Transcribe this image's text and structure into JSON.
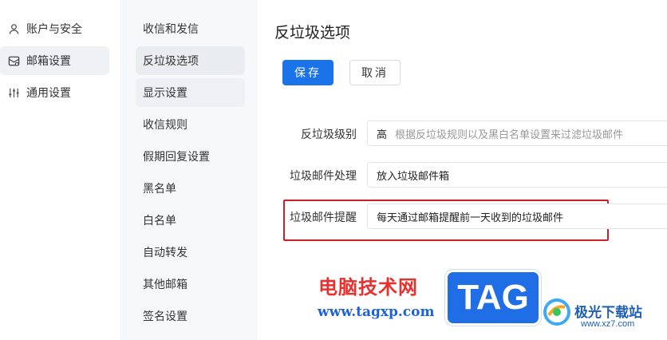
{
  "nav_primary": {
    "items": [
      {
        "label": "账户与安全",
        "icon": "user-icon"
      },
      {
        "label": "邮箱设置",
        "icon": "mailbox-icon"
      },
      {
        "label": "通用设置",
        "icon": "sliders-icon"
      }
    ],
    "active_index": 1
  },
  "nav_secondary": {
    "items": [
      {
        "label": "收信和发信"
      },
      {
        "label": "反垃圾选项"
      },
      {
        "label": "显示设置"
      },
      {
        "label": "收信规则"
      },
      {
        "label": "假期回复设置"
      },
      {
        "label": "黑名单"
      },
      {
        "label": "白名单"
      },
      {
        "label": "自动转发"
      },
      {
        "label": "其他邮箱"
      },
      {
        "label": "签名设置"
      }
    ],
    "active_index": 1
  },
  "main": {
    "title": "反垃圾选项",
    "save_label": "保存",
    "cancel_label": "取消",
    "rows": [
      {
        "label": "反垃圾级别",
        "value": "高",
        "hint": "根据反垃圾规则以及黑白名单设置来过滤垃圾邮件"
      },
      {
        "label": "垃圾邮件处理",
        "value": "放入垃圾邮件箱"
      },
      {
        "label": "垃圾邮件提醒",
        "value": "每天通过邮箱提醒前一天收到的垃圾邮件"
      }
    ]
  },
  "watermarks": {
    "site_name": "电脑技术网",
    "site_url": "www.tagxp.com",
    "tag_logo": "TAG",
    "xz_name": "极光下载站",
    "xz_url": "www.xz7.com"
  },
  "colors": {
    "accent": "#1a73e8",
    "highlight_box": "#cc1f2a"
  }
}
